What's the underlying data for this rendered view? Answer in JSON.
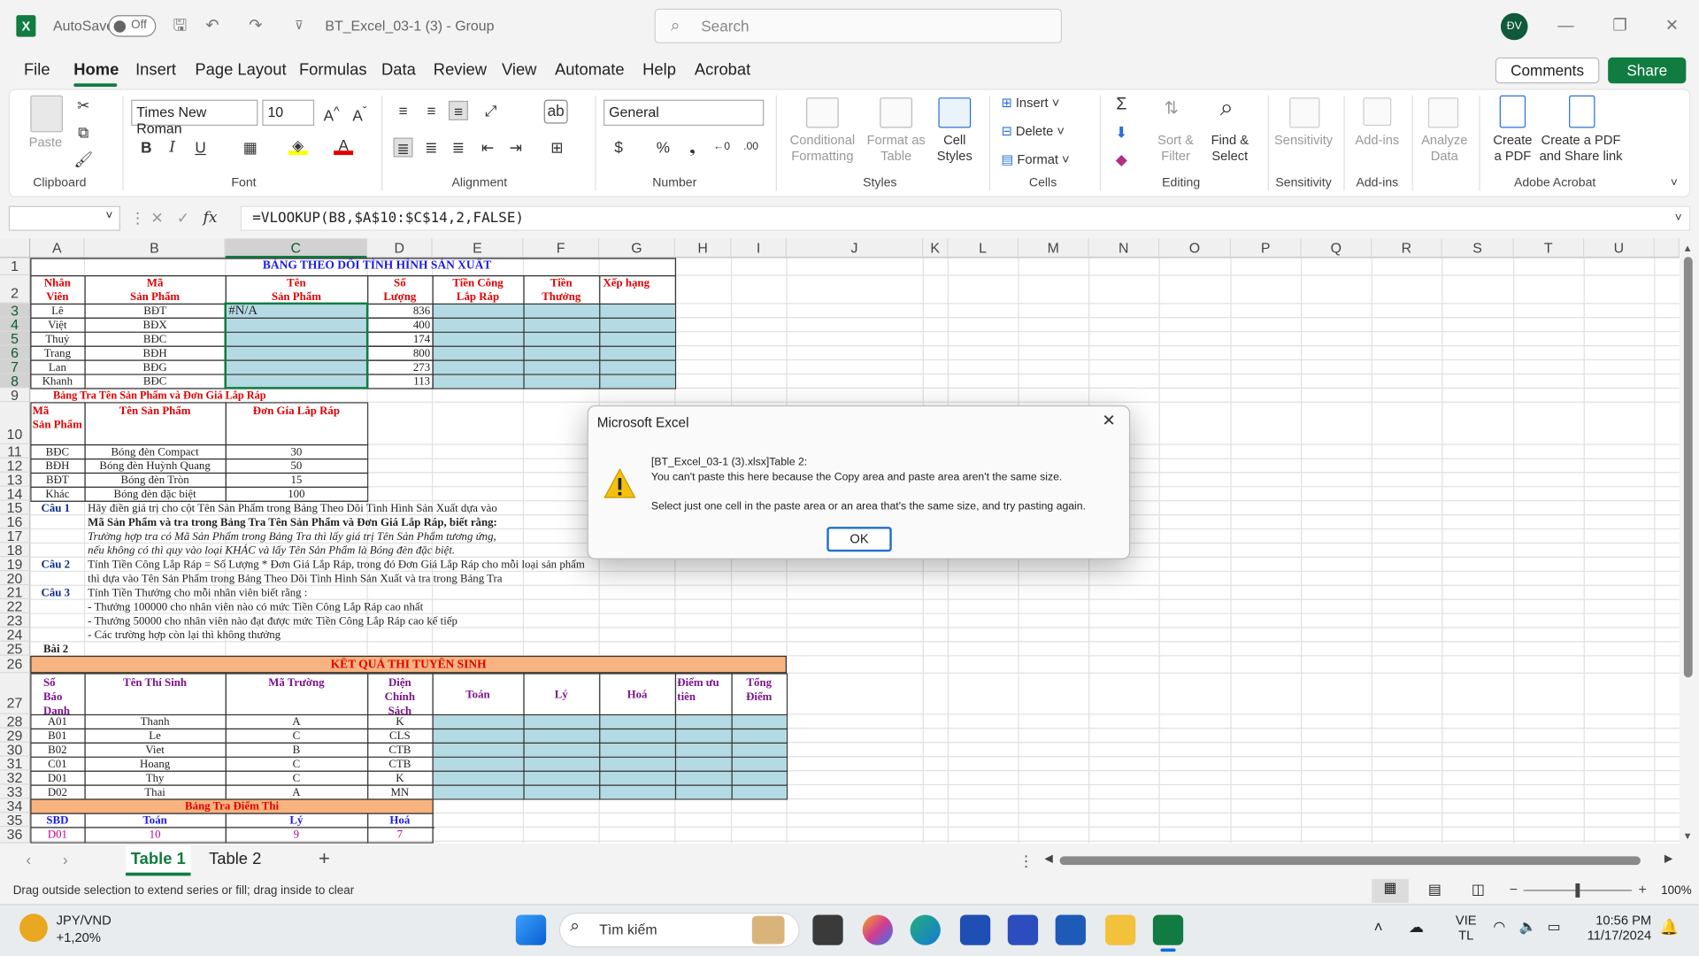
{
  "window": {
    "autosave_label": "AutoSave",
    "autosave_state": "Off",
    "file_title": "BT_Excel_03-1 (3)  -  Group",
    "search_placeholder": "Search",
    "avatar_initials": "ĐV"
  },
  "menu": {
    "items": [
      "File",
      "Home",
      "Insert",
      "Page Layout",
      "Formulas",
      "Data",
      "Review",
      "View",
      "Automate",
      "Help",
      "Acrobat"
    ],
    "comments": "Comments",
    "share": "Share"
  },
  "ribbon": {
    "clipboard": {
      "paste": "Paste",
      "label": "Clipboard"
    },
    "font": {
      "name": "Times New Roman",
      "size": "10",
      "label": "Font"
    },
    "alignment": {
      "label": "Alignment"
    },
    "number": {
      "format": "General",
      "label": "Number"
    },
    "styles": {
      "cond1": "Conditional",
      "cond2": "Formatting",
      "fmt1": "Format as",
      "fmt2": "Table",
      "cell1": "Cell",
      "cell2": "Styles",
      "label": "Styles"
    },
    "cells": {
      "insert": "Insert",
      "delete": "Delete",
      "format": "Format",
      "label": "Cells"
    },
    "editing": {
      "sort1": "Sort &",
      "sort2": "Filter",
      "find1": "Find &",
      "find2": "Select",
      "label": "Editing"
    },
    "sensitivity": {
      "btn": "Sensitivity",
      "label": "Sensitivity"
    },
    "addins": {
      "btn": "Add-ins",
      "label": "Add-ins"
    },
    "analyze": {
      "b1": "Analyze",
      "b2": "Data"
    },
    "acrobat": {
      "c1": "Create",
      "c2": "a PDF",
      "s1": "Create a PDF",
      "s2": "and Share link",
      "label": "Adobe Acrobat"
    }
  },
  "formula": {
    "fx": "fx",
    "text": "=VLOOKUP(B8,$A$10:$C$14,2,FALSE)"
  },
  "columns": [
    "A",
    "B",
    "C",
    "D",
    "E",
    "F",
    "G",
    "H",
    "I",
    "J",
    "K",
    "L",
    "M",
    "N",
    "O",
    "P",
    "Q",
    "R",
    "S",
    "T",
    "U"
  ],
  "rows": [
    "1",
    "2",
    "3",
    "4",
    "5",
    "6",
    "7",
    "8",
    "9",
    "10",
    "11",
    "12",
    "13",
    "14",
    "15",
    "16",
    "17",
    "18",
    "19",
    "20",
    "21",
    "22",
    "23",
    "24",
    "25",
    "26",
    "27",
    "28",
    "29",
    "30",
    "31",
    "32",
    "33",
    "34",
    "35",
    "36"
  ],
  "sheet": {
    "title1": "BẢNG THEO DÕI TÌNH HÌNH SẢN XUẤT",
    "hdr": {
      "a1": "Nhân",
      "a2": "Viên",
      "b1": "Mã",
      "b2": "Sản Phẩm",
      "c1": "Tên",
      "c2": "Sản Phẩm",
      "d1": "Số",
      "d2": "Lượng",
      "e1": "Tiền Công",
      "e2": "Lắp Ráp",
      "f1": "Tiền",
      "f2": "Thưởng",
      "g1": "Xếp hạng"
    },
    "prod_rows": [
      [
        "Lê",
        "BĐT",
        "#N/A",
        "836"
      ],
      [
        "Việt",
        "BĐX",
        "",
        "400"
      ],
      [
        "Thuỷ",
        "BĐC",
        "",
        "174"
      ],
      [
        "Trang",
        "BĐH",
        "",
        "800"
      ],
      [
        "Lan",
        "BĐG",
        "",
        "273"
      ],
      [
        "Khanh",
        "BĐC",
        "",
        "113"
      ]
    ],
    "lookup_title": "Bảng Tra Tên Sản Phẩm và Đơn Giá Lắp Ráp",
    "lookup_hdr": {
      "a1": "Mã",
      "a2": "Sản Phẩm",
      "b": "Tên Sản Phẩm",
      "c": "Đơn Gía Lắp Ráp"
    },
    "lookup_rows": [
      [
        "BĐC",
        "Bóng đèn Compact",
        "30"
      ],
      [
        "BĐH",
        "Bóng đèn Huỳnh Quang",
        "50"
      ],
      [
        "BĐT",
        "Bóng đèn Tròn",
        "15"
      ],
      [
        "Khác",
        "Bóng đèn đặc biệt",
        "100"
      ]
    ],
    "q1": "Câu 1",
    "q1_l1": "Hãy điền giá trị cho cột Tên Sản Phẩm trong Bảng Theo Dõi Tình Hình Sản Xuất dựa vào",
    "q1_l2": "Mã Sản Phẩm và tra trong Bảng Tra Tên Sản Phẩm và Đơn Giá Lắp Ráp, biết rằng:",
    "q1_l3": "Trường hợp tra có  Mã Sản Phẩm trong  Bảng Tra thì lấy giá trị  Tên Sản Phẩm tương ứng,",
    "q1_l4": "nếu không có thì quy vào loại  KHÁC và lấy  Tên Sản Phẩm là  Bóng đèn đặc biệt.",
    "q2": "Câu 2",
    "q2_l1": "Tính Tiền Công Lắp Ráp = Số Lượng * Đơn Giá Lắp Ráp, trong đó Đơn Giá Lắp Ráp cho mỗi loại sản phẩm",
    "q2_l2": "thì dựa vào Tên Sản Phẩm trong Bảng Theo Dõi Tình Hình Sản Xuất và tra trong Bảng Tra",
    "q3": "Câu 3",
    "q3_l1": "Tính Tiền Thưởng cho mỗi nhân viên biết rằng :",
    "q3_l2": "- Thưởng 100000 cho nhân viên nào có mức Tiền Công Lắp Ráp cao nhất",
    "q3_l3": "- Thưởng 50000 cho nhân viên nào đạt được mức Tiền Công Lắp Ráp cao kế tiếp",
    "q3_l4": "- Các trường hợp còn lại thì không thưởng",
    "bai2": "Bài 2",
    "title2": "KẾT QUẢ THI TUYỂN SINH",
    "hdr2": {
      "a1": "Số",
      "a2": "Báo",
      "a3": "Danh",
      "b": "Tên Thí Sinh",
      "c": "Mã Trường",
      "d1": "Diện",
      "d2": "Chính",
      "d3": "Sách",
      "e": "Toán",
      "f": "Lý",
      "g": "Hoá",
      "h1": "Điểm ưu",
      "h2": "tiên",
      "i1": "Tổng",
      "i2": "Điểm"
    },
    "exam_rows": [
      [
        "A01",
        "Thanh",
        "A",
        "K"
      ],
      [
        "B01",
        "Le",
        "C",
        "CLS"
      ],
      [
        "B02",
        "Viet",
        "B",
        "CTB"
      ],
      [
        "C01",
        "Hoang",
        "C",
        "CTB"
      ],
      [
        "D01",
        "Thy",
        "C",
        "K"
      ],
      [
        "D02",
        "Thai",
        "A",
        "MN"
      ]
    ],
    "score_title": "Bảng Tra Điểm Thi",
    "score_hdr": [
      "SBD",
      "Toán",
      "Lý",
      "Hoá"
    ],
    "score_row": [
      "D01",
      "10",
      "9",
      "7"
    ]
  },
  "dialog": {
    "title": "Microsoft Excel",
    "line1": "[BT_Excel_03-1 (3).xlsx]Table 2:",
    "line2": "You can't paste this here because the Copy area and paste area aren't the same size.",
    "line3": "Select just one cell in the paste area or an area that's the same size, and try pasting again.",
    "ok": "OK"
  },
  "tabs": {
    "t1": "Table 1",
    "t2": "Table 2"
  },
  "status": {
    "msg": "Drag outside selection to extend series or fill; drag inside to clear",
    "zoom": "100%"
  },
  "taskbar": {
    "ticker": "JPY/VND",
    "change": "+1,20%",
    "search": "Tìm kiếm",
    "lang1": "VIE",
    "lang2": "TL",
    "time": "10:56 PM",
    "date": "11/17/2024"
  }
}
